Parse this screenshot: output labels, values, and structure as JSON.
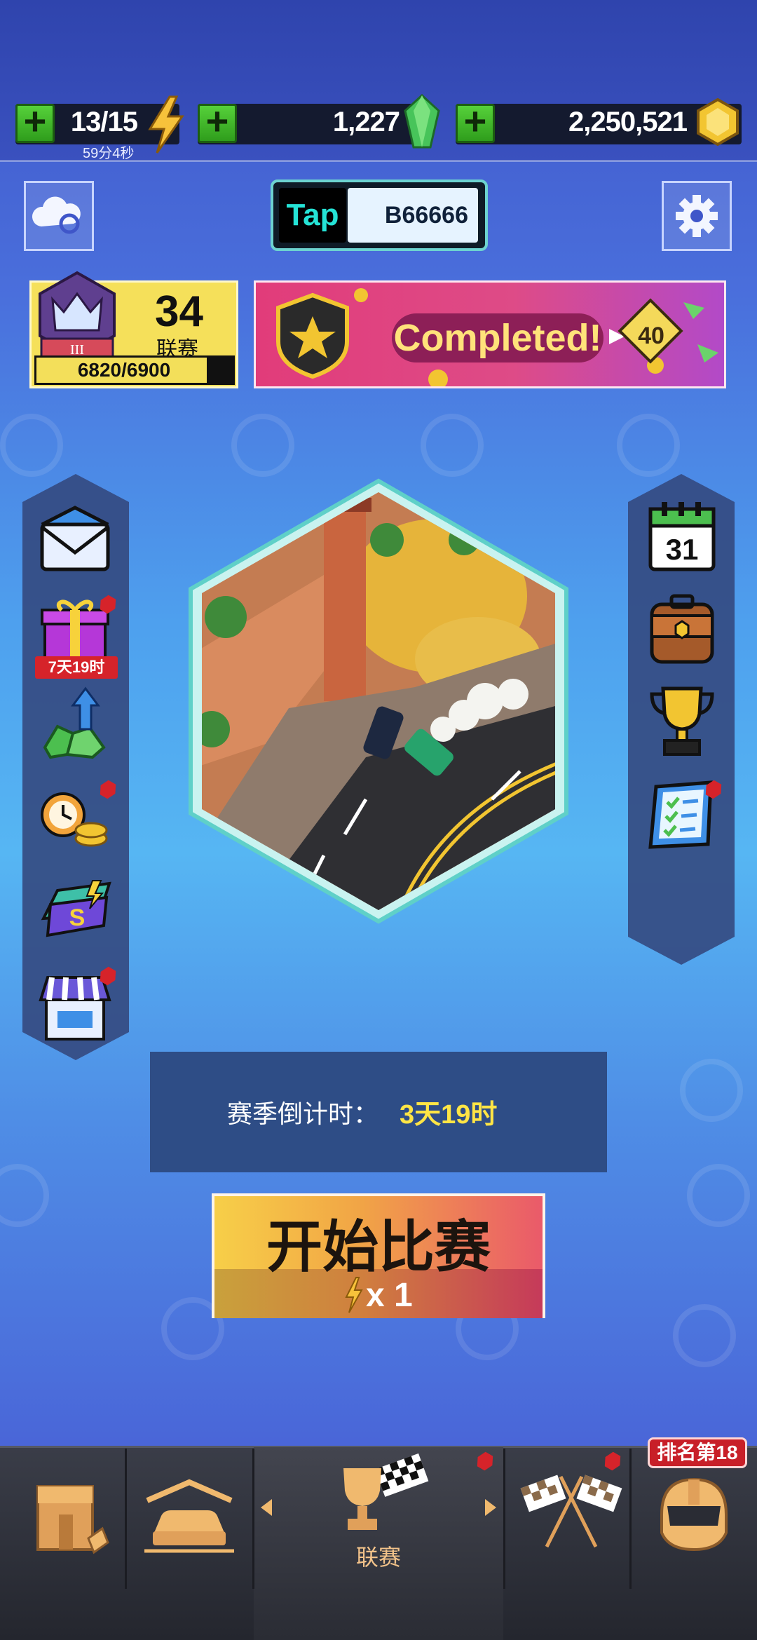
{
  "resources": {
    "energy": {
      "value": "13/15",
      "timer": "59分4秒",
      "icon": "lightning-bolt-icon"
    },
    "gems": {
      "value": "1,227",
      "icon": "green-gem-icon"
    },
    "coins": {
      "value": "2,250,521",
      "icon": "gold-coin-icon"
    },
    "add_symbol": "+"
  },
  "plate": {
    "brand": "Tap",
    "code": "B66666"
  },
  "league": {
    "tier": "III",
    "number": "34",
    "label": "联赛",
    "progress_text": "6820/6900",
    "progress": 0.988
  },
  "banner": {
    "text": "Completed!",
    "reward": "40"
  },
  "left_menu": {
    "gift_timer": "7天19时"
  },
  "right_menu": {
    "calendar_day": "31"
  },
  "countdown": {
    "label": "赛季倒计时：",
    "value": "3天19时"
  },
  "start": {
    "title": "开始比赛",
    "cost": "x 1"
  },
  "bottom_nav": {
    "active_label": "联赛",
    "rank_tag": "排名第18"
  },
  "colors": {
    "accent_yellow": "#ffe545",
    "alert_red": "#d6232a",
    "energy_green": "#56d13a"
  }
}
